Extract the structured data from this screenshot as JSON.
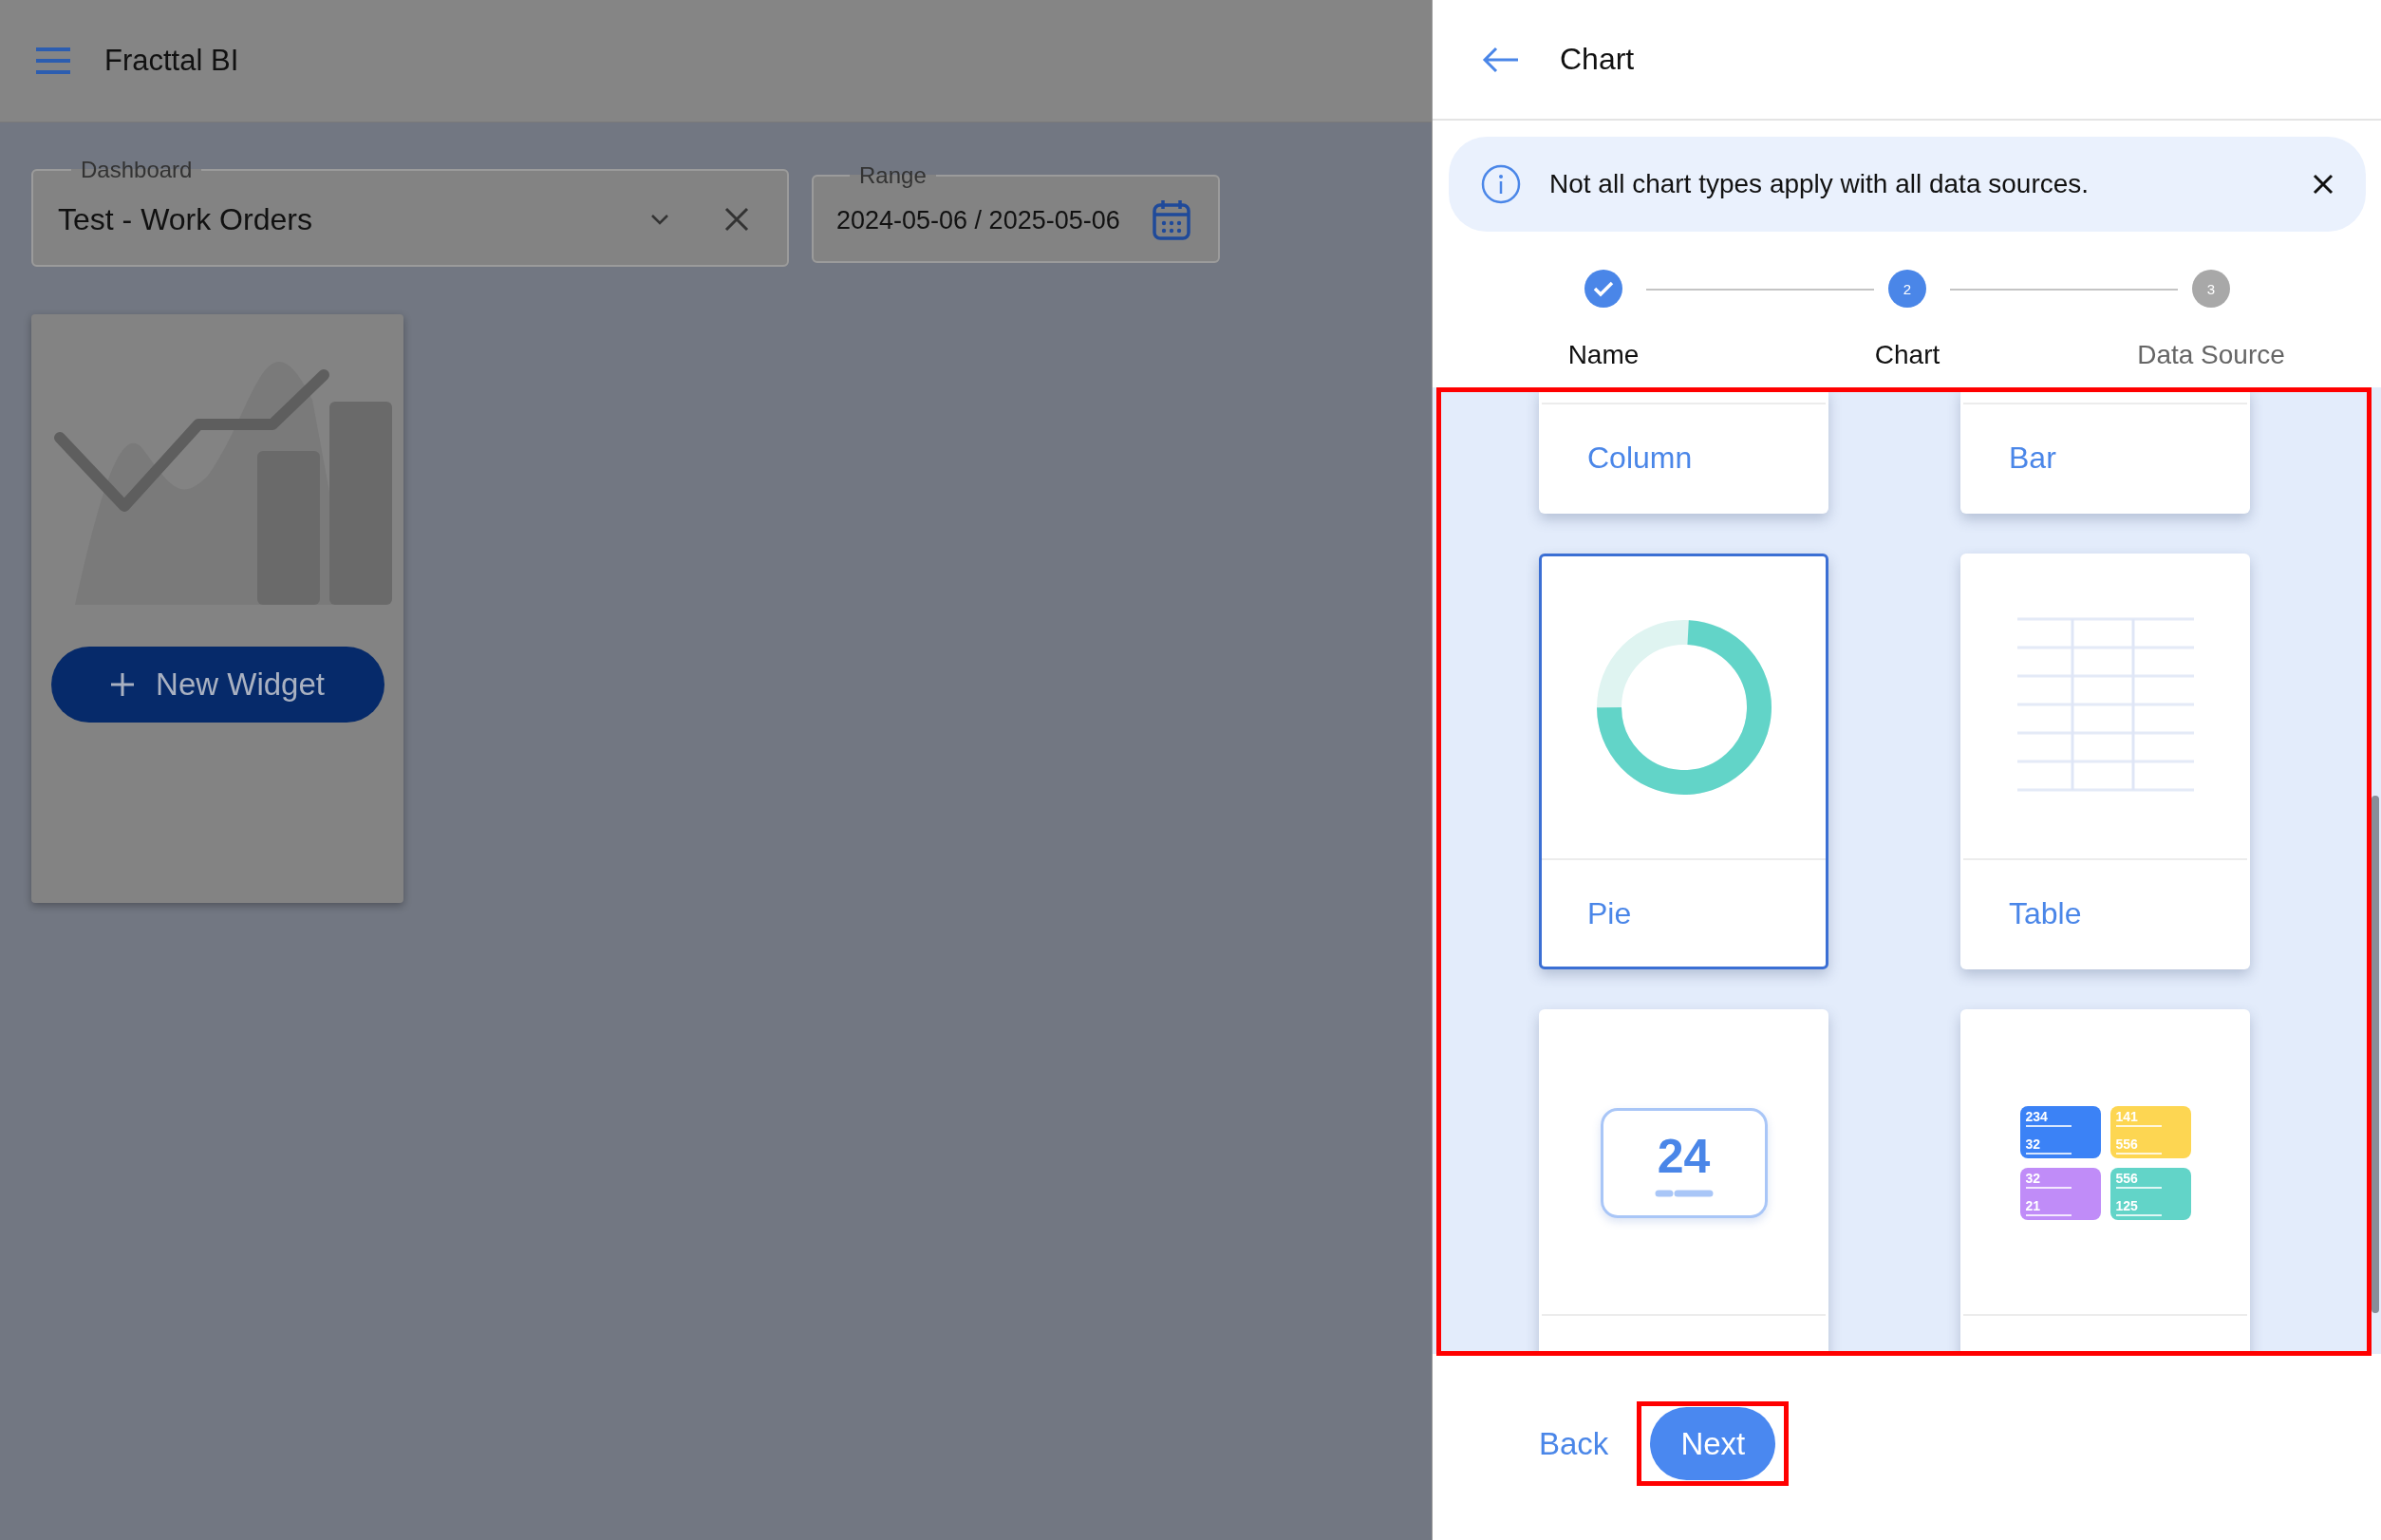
{
  "app_bar": {
    "title": "Fracttal BI"
  },
  "filters": {
    "dashboard": {
      "label": "Dashboard",
      "value": "Test - Work Orders"
    },
    "range": {
      "label": "Range",
      "value": "2024-05-06 / 2025-05-06"
    }
  },
  "widget_card": {
    "button": "New Widget"
  },
  "drawer": {
    "title": "Chart",
    "banner": {
      "text": "Not all chart types apply with all data sources."
    },
    "steps": [
      {
        "label": "Name",
        "kind": "done"
      },
      {
        "label": "Chart",
        "number": "2",
        "kind": "active"
      },
      {
        "label": "Data Source",
        "number": "3",
        "kind": "pending"
      }
    ],
    "chart_types": {
      "highlighted": true,
      "cards": [
        {
          "label": "Column",
          "selected": false
        },
        {
          "label": "Bar",
          "selected": false
        },
        {
          "kind": "donut",
          "label": "Pie",
          "selected": true
        },
        {
          "kind": "table",
          "label": "Table",
          "selected": false
        },
        {
          "kind": "number",
          "number": "24",
          "selected": false
        },
        {
          "kind": "tiles",
          "selected": false,
          "tiles": [
            {
              "color": "#3b82f6",
              "values": [
                "234",
                "32"
              ]
            },
            {
              "color": "#fdd652",
              "values": [
                "141",
                "556"
              ]
            },
            {
              "color": "#c08cf8",
              "values": [
                "32",
                "21"
              ]
            },
            {
              "color": "#62d4c8",
              "values": [
                "556",
                "125"
              ]
            }
          ]
        }
      ]
    },
    "back_button": "Back",
    "next_button": {
      "label": "Next",
      "highlighted": true
    }
  }
}
